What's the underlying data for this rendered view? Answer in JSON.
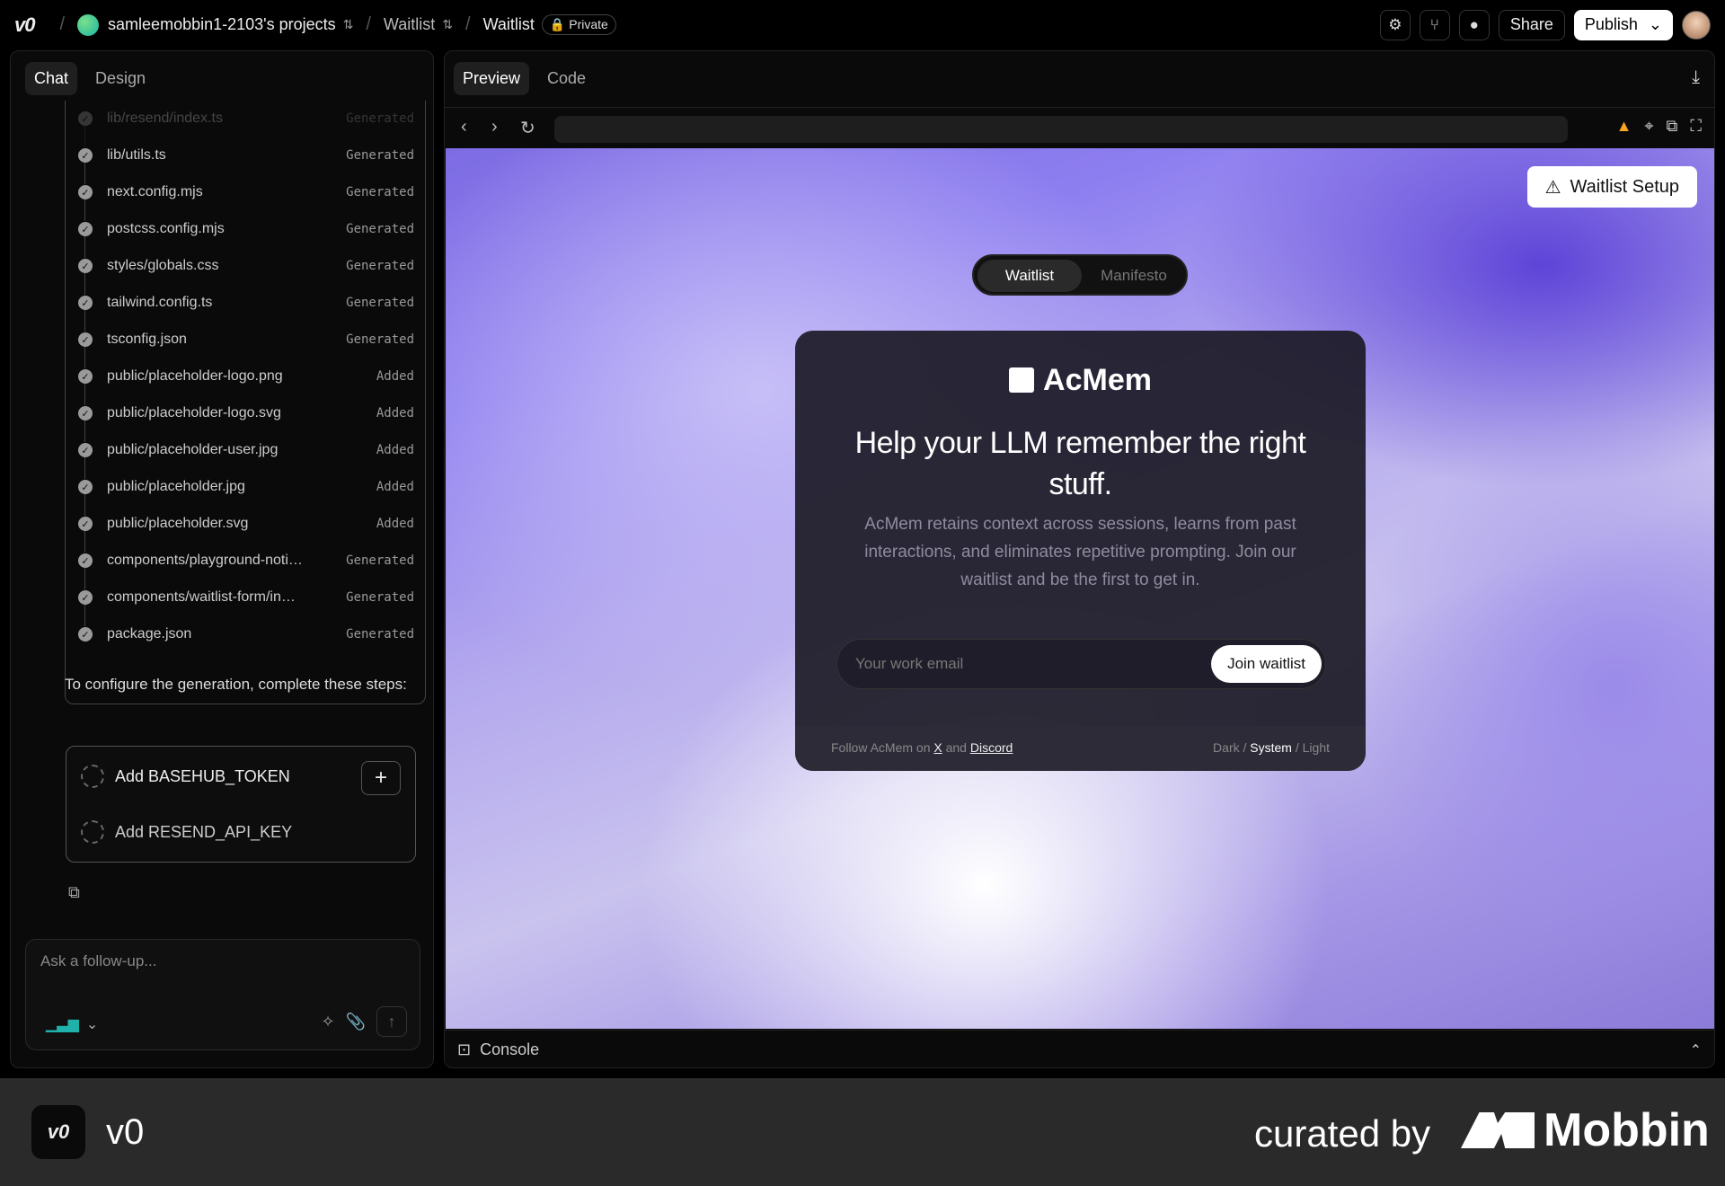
{
  "topbar": {
    "logo": "v0",
    "project": "samleemobbin1-2103's projects",
    "crumb1": "Waitlist",
    "crumb2": "Waitlist",
    "private": "Private",
    "share": "Share",
    "publish": "Publish"
  },
  "left": {
    "tabs": [
      "Chat",
      "Design"
    ],
    "files": [
      {
        "name": "lib/resend/index.ts",
        "status": "Generated"
      },
      {
        "name": "lib/utils.ts",
        "status": "Generated"
      },
      {
        "name": "next.config.mjs",
        "status": "Generated"
      },
      {
        "name": "postcss.config.mjs",
        "status": "Generated"
      },
      {
        "name": "styles/globals.css",
        "status": "Generated"
      },
      {
        "name": "tailwind.config.ts",
        "status": "Generated"
      },
      {
        "name": "tsconfig.json",
        "status": "Generated"
      },
      {
        "name": "public/placeholder-logo.png",
        "status": "Added"
      },
      {
        "name": "public/placeholder-logo.svg",
        "status": "Added"
      },
      {
        "name": "public/placeholder-user.jpg",
        "status": "Added"
      },
      {
        "name": "public/placeholder.jpg",
        "status": "Added"
      },
      {
        "name": "public/placeholder.svg",
        "status": "Added"
      },
      {
        "name": "components/playground-noti…",
        "status": "Generated"
      },
      {
        "name": "components/waitlist-form/in…",
        "status": "Generated"
      },
      {
        "name": "package.json",
        "status": "Generated"
      }
    ],
    "instructions": "To configure the generation, complete these steps:",
    "steps": [
      "Add BASEHUB_TOKEN",
      "Add RESEND_API_KEY"
    ],
    "chat_placeholder": "Ask a follow-up..."
  },
  "right": {
    "tabs": [
      "Preview",
      "Code"
    ],
    "console": "Console"
  },
  "preview": {
    "setup_btn": "Waitlist Setup",
    "toggle": [
      "Waitlist",
      "Manifesto"
    ],
    "brand": "AcMem",
    "headline": "Help your LLM remember the right stuff.",
    "sub": "AcMem retains context across sessions, learns from past interactions, and eliminates repetitive prompting. Join our waitlist and be the first to get in.",
    "email_placeholder": "Your work email",
    "join": "Join waitlist",
    "follow_prefix": "Follow AcMem on",
    "x": "X",
    "and": "and",
    "discord": "Discord",
    "themes": [
      "Dark",
      "System",
      "Light"
    ]
  },
  "footer": {
    "app": "v0",
    "curated": "curated by",
    "brand": "Mobbin"
  }
}
